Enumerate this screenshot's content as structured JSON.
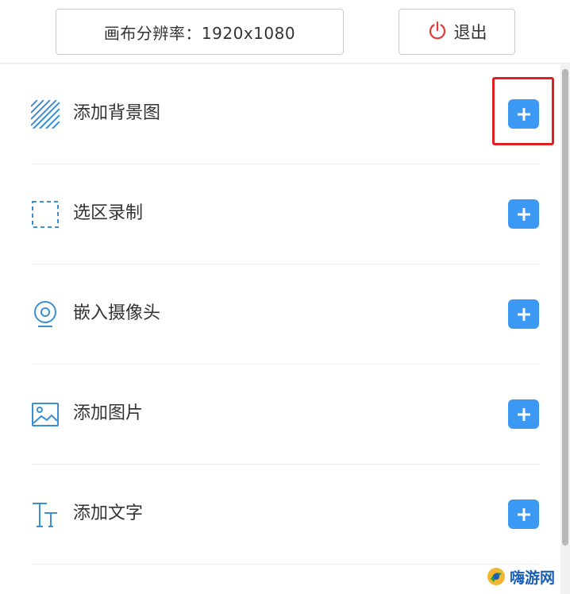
{
  "header": {
    "resolution_label": "画布分辨率：1920x1080",
    "exit_label": "退出",
    "exit_icon": "power-icon"
  },
  "items": [
    {
      "label": "添加背景图",
      "icon": "hatch-pattern-icon"
    },
    {
      "label": "选区录制",
      "icon": "dashed-selection-icon"
    },
    {
      "label": "嵌入摄像头",
      "icon": "webcam-icon"
    },
    {
      "label": "添加图片",
      "icon": "image-icon"
    },
    {
      "label": "添加文字",
      "icon": "text-icon"
    }
  ],
  "colors": {
    "accent": "#3b99f4",
    "icon": "#3b8fd6",
    "exit_icon": "#e53935",
    "highlight": "#e02020"
  },
  "watermark": {
    "text": "嗨游网"
  }
}
